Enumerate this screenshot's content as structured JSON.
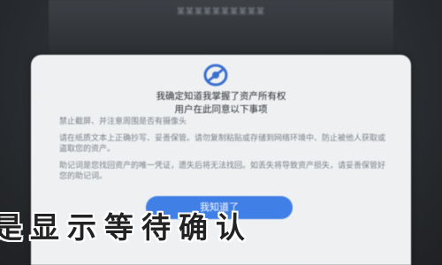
{
  "status_bar": {
    "text": "某某某某某某某某某某"
  },
  "dialog": {
    "logo_icon": "wallet-shield-icon",
    "title_lines": [
      "我确定知道我掌握了资产所有权",
      "用户在此同意以下事项"
    ],
    "paragraphs": [
      "禁止截屏、并注意周围是否有摄像头",
      "请在纸质文本上正确抄写、妥善保管。请勿复制粘贴或存储到网络环境中、防止被他人获取或盗取您的资产。",
      "助记词是您找回资产的唯一凭证，遗失后将无法找回。如丢失将导致资产损失，请妥善保管好您的助记词。"
    ],
    "confirm_label": "我知道了",
    "accent_color": "#3f7fe6"
  },
  "overlay": {
    "caption": "是显示等待确认"
  }
}
